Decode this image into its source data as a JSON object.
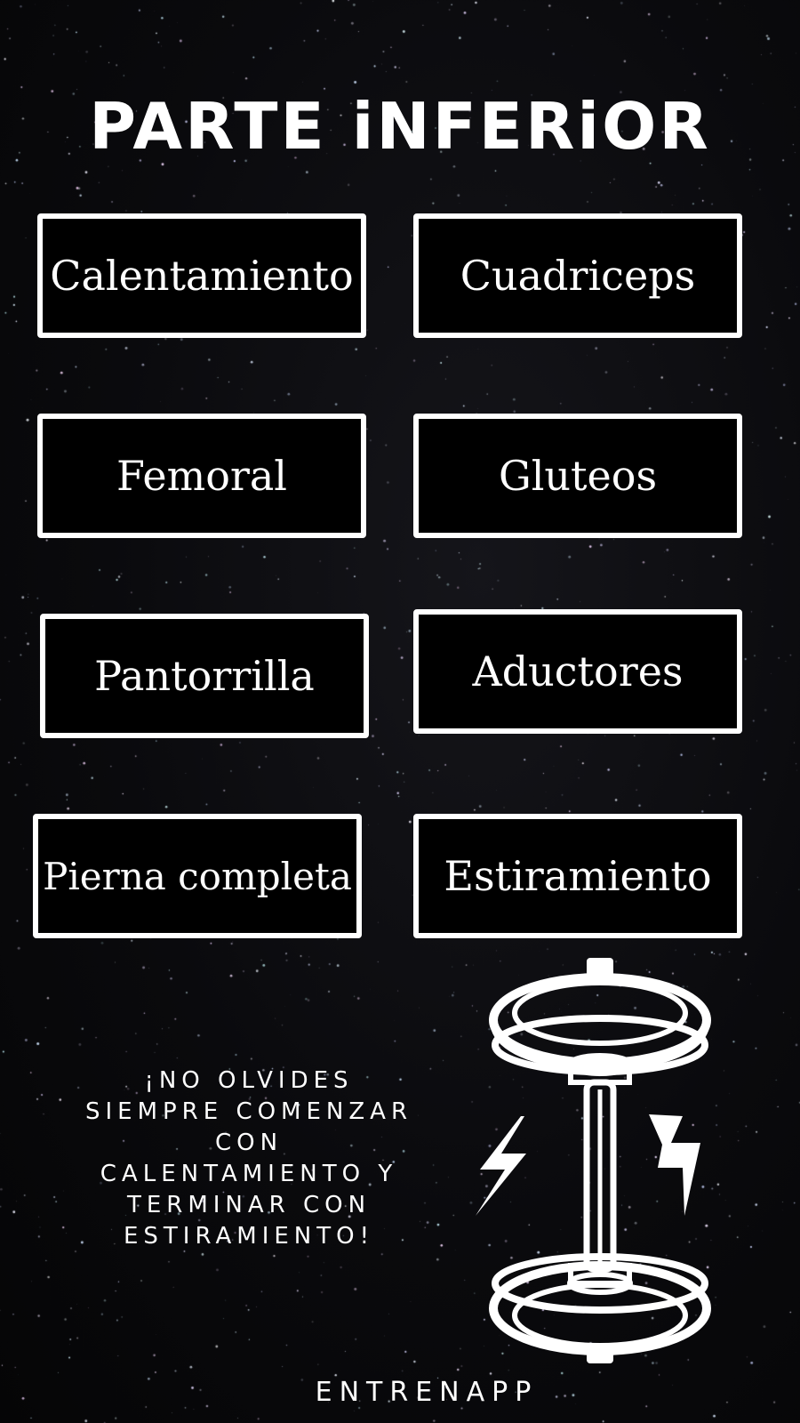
{
  "title": "PARTE iNFERiOR",
  "buttons": [
    {
      "label": "Calentamiento"
    },
    {
      "label": "Cuadriceps"
    },
    {
      "label": "Femoral"
    },
    {
      "label": "Gluteos"
    },
    {
      "label": "Pantorrilla"
    },
    {
      "label": "Aductores"
    },
    {
      "label": "Pierna completa"
    },
    {
      "label": "Estiramiento"
    }
  ],
  "reminder": {
    "lines": [
      "¡NO OLVIDES",
      "SIEMPRE COMENZAR",
      "CON",
      "CALENTAMIENTO Y",
      "TERMINAR CON",
      "ESTIRAMIENTO!"
    ]
  },
  "brand": "ENTRENAPP",
  "icons": [
    "dumbbell-icon",
    "lightning-left-icon",
    "lightning-right-icon"
  ],
  "colors": {
    "background": "#0a0a0d",
    "foreground": "#ffffff"
  }
}
